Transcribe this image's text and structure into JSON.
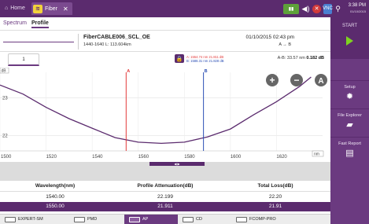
{
  "topbar": {
    "home_label": "Home",
    "fiber_tab_label": "Fiber",
    "fiber_icon_glyph": "≋",
    "close_glyph": "✕",
    "vnc_label": "VNC",
    "clock_time": "3:38 PM",
    "clock_date": "01/10/2015"
  },
  "sidebar": {
    "start_label": "START",
    "setup_label": "Setup",
    "file_explorer_label": "File Explorer",
    "fast_report_label": "Fast Report"
  },
  "subtabs": {
    "spectrum": "Spectrum",
    "profile": "Profile"
  },
  "header": {
    "fiber_name": "FiberCABLE006_SCL_OE",
    "range_info": "1440-1640   L: 113.604km",
    "date": "01/10/2015 02:43 pm",
    "direction": "A → B"
  },
  "trace": {
    "tab_label": "1",
    "cursor_a": "A: 1554.74 nm  21.811 dB",
    "cursor_b": "B: 1588.31 nm  21.828 dB",
    "ab_label": "A-B: 33.57 nm",
    "ab_value": "0.182 dB"
  },
  "graph": {
    "y_unit": "dB",
    "x_unit": "nm",
    "y_ticks": [
      "23",
      "22"
    ],
    "x_ticks": [
      "1500",
      "1520",
      "1540",
      "1560",
      "1580",
      "1600",
      "1620"
    ],
    "marker_a": "A",
    "marker_b": "B",
    "zoom_in": "+",
    "zoom_out": "−",
    "auto": "A"
  },
  "chart_data": {
    "type": "line",
    "xlabel": "nm",
    "ylabel": "dB",
    "xlim": [
      1500,
      1640
    ],
    "ylim": [
      21.6,
      23.8
    ],
    "series": [
      {
        "x": [
          1500,
          1510,
          1520,
          1530,
          1540,
          1550,
          1560,
          1570,
          1580,
          1590,
          1600,
          1610,
          1620,
          1630,
          1635
        ],
        "values": [
          23.34,
          23.1,
          22.75,
          22.45,
          22.2,
          21.95,
          21.83,
          21.8,
          21.83,
          21.97,
          22.18,
          22.55,
          22.9,
          23.3,
          23.55
        ]
      }
    ],
    "cursors": [
      {
        "label": "A",
        "x": 1554.74,
        "color": "#e23b3b"
      },
      {
        "label": "B",
        "x": 1588.31,
        "color": "#2b4fb5"
      }
    ]
  },
  "results": {
    "headers": [
      "Wavelength(nm)",
      "Profile Attenuation(dB)",
      "Total Loss(dB)"
    ],
    "rows": [
      [
        "1540.00",
        "22.199",
        "22.20"
      ],
      [
        "1550.00",
        "21.911",
        "21.91"
      ]
    ]
  },
  "bottombar": {
    "items": [
      "EXPERT-SM",
      "PMD",
      "AP",
      "CD",
      "FCOMP-PRO"
    ],
    "active": "AP"
  }
}
